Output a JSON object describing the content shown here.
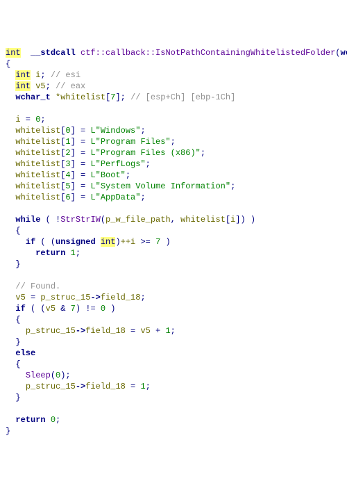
{
  "sig": {
    "ret_type": "int",
    "callconv": "__stdcall",
    "ns": "ctf::callback::IsNotPathContainingWhitelistedFolder",
    "param_type": "wchar_"
  },
  "decl": {
    "int1": "int",
    "i": "i",
    "c1": "// esi",
    "int2": "int",
    "v5": "v5",
    "c2": "// eax",
    "wl_type": "wchar_t",
    "wl_name": "*whitelist",
    "wl_dim": "7",
    "c3": "// [esp+Ch] [ebp-1Ch]"
  },
  "body": {
    "init": "i = 0;",
    "wl0": {
      "idx": "0",
      "val": "\"Windows\""
    },
    "wl1": {
      "idx": "1",
      "val": "\"Program Files\""
    },
    "wl2": {
      "idx": "2",
      "val": "\"Program Files (x86)\""
    },
    "wl3": {
      "idx": "3",
      "val": "\"PerfLogs\""
    },
    "wl4": {
      "idx": "4",
      "val": "\"Boot\""
    },
    "wl5": {
      "idx": "5",
      "val": "\"System Volume Information\""
    },
    "wl6": {
      "idx": "6",
      "val": "\"AppData\""
    },
    "while_kw": "while",
    "strstr": "StrStrIW",
    "arg1": "p_w_file_path",
    "arg2a": "whitelist",
    "arg2b": "i",
    "if_kw": "if",
    "unsigned": "unsigned",
    "int_cast": "int",
    "inc": "++i >= ",
    "seven": "7",
    "return_kw": "return",
    "one": "1",
    "found_c": "// Found.",
    "v5a": "v5",
    "eq": " = ",
    "ps": "p_struc_15",
    "arrow": "->",
    "f18": "field_18",
    "seven2": "7",
    "zero": "0",
    "plus1": " + ",
    "one2": "1",
    "else_kw": "else",
    "sleep": "Sleep",
    "sleep_arg": "0",
    "one3": "1",
    "zero2": "0"
  }
}
